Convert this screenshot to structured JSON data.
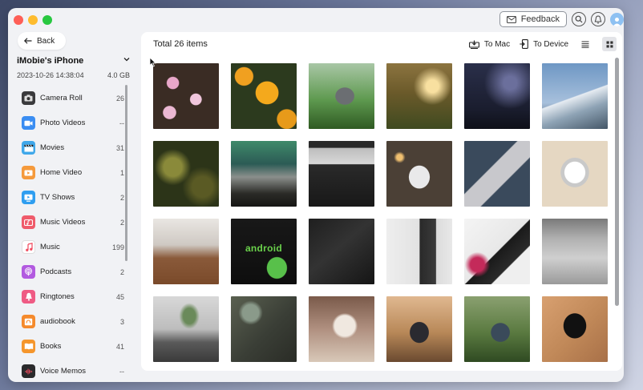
{
  "window": {
    "feedback_label": "Feedback"
  },
  "sidebar": {
    "back_label": "Back",
    "device_name": "iMobie's iPhone",
    "device_date": "2023-10-26 14:38:04",
    "device_size": "4.0 GB",
    "items": [
      {
        "label": "Camera Roll",
        "count": "26",
        "icon": "camera-icon",
        "color": "#3a3a3c"
      },
      {
        "label": "Photo Videos",
        "count": "--",
        "icon": "photo-video-icon",
        "color": "#3a8df2"
      },
      {
        "label": "Movies",
        "count": "31",
        "icon": "clapperboard-icon",
        "color": "#40a8ea"
      },
      {
        "label": "Home Video",
        "count": "1",
        "icon": "home-video-icon",
        "color": "#f59a3c"
      },
      {
        "label": "TV Shows",
        "count": "2",
        "icon": "tv-icon",
        "color": "#2f9ef0"
      },
      {
        "label": "Music Videos",
        "count": "2",
        "icon": "music-video-icon",
        "color": "#ef5b6b"
      },
      {
        "label": "Music",
        "count": "199",
        "icon": "music-note-icon",
        "color": "#ffffff"
      },
      {
        "label": "Podcasts",
        "count": "2",
        "icon": "podcast-icon",
        "color": "#b25ae0"
      },
      {
        "label": "Ringtones",
        "count": "45",
        "icon": "bell-icon",
        "color": "#ef5b84"
      },
      {
        "label": "audiobook",
        "count": "3",
        "icon": "audiobook-icon",
        "color": "#f58a2c"
      },
      {
        "label": "Books",
        "count": "41",
        "icon": "book-icon",
        "color": "#f5962c"
      },
      {
        "label": "Voice Memos",
        "count": "--",
        "icon": "voice-memo-icon",
        "color": "#2a2a2c"
      }
    ]
  },
  "main": {
    "title": "Total 26 items",
    "to_mac_label": "To Mac",
    "to_device_label": "To Device",
    "photos": [
      {
        "name": "photo-pink-daisies",
        "bg": "radial-gradient(circle at 30% 30%,#e8a7c9 0 9%,transparent 10%),radial-gradient(circle at 65% 55%,#f0c6dc 0 10%,transparent 11%),radial-gradient(circle at 25% 75%,#ebb8d3 0 9%,transparent 10%),#3a2c24"
      },
      {
        "name": "photo-orange-flowers",
        "bg": "radial-gradient(circle at 55% 45%,#f4a91c 0 22%,transparent 23%),radial-gradient(circle at 20% 20%,#f0a020 0 12%,transparent 13%),radial-gradient(circle at 85% 85%,#e79a1a 0 12%,transparent 13%),#2c3a1e"
      },
      {
        "name": "photo-cat-grass",
        "bg": "radial-gradient(ellipse at 55% 50%,#6b6e72 0 18%,transparent 19%),linear-gradient(180deg,#a9c7a6 0%,#5f9a50 55%,#2f5a22 100%)"
      },
      {
        "name": "photo-sunset-field",
        "bg": "radial-gradient(circle at 70% 35%,#f8e0a0 0 10%,transparent 30%),linear-gradient(180deg,#8c7440 0%,#6b5a2a 45%,#3f4a20 100%)"
      },
      {
        "name": "photo-night-sky",
        "bg": "radial-gradient(ellipse at 70% 30%,#6b6f9c 0 10%,transparent 40%),linear-gradient(180deg,#2a2f4a 0%,#1a1d2e 70%,#0e1018 100%)"
      },
      {
        "name": "photo-snowy-mountain",
        "bg": "linear-gradient(160deg,transparent 50%,#e6ecf2 51%,#8ea3b5 70%,#445667 100%),linear-gradient(180deg,#6e97c4 0%,#a7c0dc 60%,#3a4c5c 100%)"
      },
      {
        "name": "photo-tree-canopy",
        "bg": "radial-gradient(circle at 30% 40%,#8a8a3a 0 15%,transparent 30%),radial-gradient(circle at 75% 70%,#5a5a24 0 15%,transparent 30%),#2c3418"
      },
      {
        "name": "photo-aurora-mountains",
        "bg": "linear-gradient(180deg,#3f8a6a 0%,#2c5b55 35%,#8b8f8c 55%,#2b2b27 80%,#161614 100%)"
      },
      {
        "name": "photo-laptop-top",
        "bg": "linear-gradient(180deg,#2a2a2a 0%,#2a2a2a 10%,#bdbdbd 11%,#d8d8d8 35%,#2a2a2a 36%,#181818 100%)"
      },
      {
        "name": "photo-iphone-lights",
        "bg": "radial-gradient(ellipse at 50% 55%,#e9e9ea 0 22%,transparent 23%),radial-gradient(circle at 20% 25%,#f0c070 0 4%,transparent 8%),#4b4036"
      },
      {
        "name": "photo-iphone-pencil",
        "bg": "linear-gradient(135deg,transparent 40%,#c8c8cc 41%,#c8c8cc 62%,transparent 63%),#3a4a5c"
      },
      {
        "name": "photo-ipad-desk",
        "bg": "radial-gradient(ellipse at 50% 48%,#ffffff 0 22%,#c9c9c9 23%,#c9c9c9 30%,transparent 31%),#e5d7c2"
      },
      {
        "name": "photo-laptop-wood-desk",
        "bg": "linear-gradient(180deg,#e9e6e2 0%,#cfc9c3 40%,#8a5a3a 60%,#7a4a2a 100%)"
      },
      {
        "name": "photo-android-robot",
        "bg": "radial-gradient(ellipse at 70% 75%,#58c04a 0 15%,transparent 16%),linear-gradient(180deg,#181818 0%,#0e0e0e 100%)",
        "label": "android"
      },
      {
        "name": "photo-dark-phones",
        "bg": "linear-gradient(140deg,#1f1f1f 0%,#333 45%,#151515 100%)"
      },
      {
        "name": "photo-phone-notebook",
        "bg": "linear-gradient(90deg,#eeeeee 0%,#e2e2e2 50%,#2a2a2a 51%,#3a3a3a 75%,#dcdcdc 76%,#e8e8e8 100%)"
      },
      {
        "name": "photo-earbuds-phone",
        "bg": "radial-gradient(circle at 20% 70%,#c42a5a 0 10%,transparent 18%),linear-gradient(135deg,#f4f4f4 0%,#e8e8e8 50%,#1a1a1a 51%,#2a2a2a 70%,#efefef 71%,#efefef 100%)"
      },
      {
        "name": "photo-desk-setup",
        "bg": "linear-gradient(180deg,#7a7a7a 0%,#b0b0b0 30%,#cfcfcf 60%,#9a9a9a 100%)"
      },
      {
        "name": "photo-laptop-plant",
        "bg": "radial-gradient(ellipse at 55% 30%,#6a8a5a 0 12%,transparent 20%),linear-gradient(180deg,#d8d8d8 0%,#bdbdbd 50%,#5a5a5a 70%,#3a3a3a 100%)"
      },
      {
        "name": "photo-phone-table-top",
        "bg": "radial-gradient(circle at 30% 25%,#8a9a8a 0 12%,transparent 18%),linear-gradient(135deg,#5a6050 0%,#3a3e36 55%,#2a2c26 100%)"
      },
      {
        "name": "photo-hand-phone-coffee",
        "bg": "radial-gradient(ellipse at 55% 45%,#f0e8e0 0 20%,transparent 25%),linear-gradient(180deg,#7a5a4a 0%,#b09080 50%,#d8c8b8 100%)"
      },
      {
        "name": "photo-phone-photo-food",
        "bg": "radial-gradient(ellipse at 50% 55%,#2a2a30 0 20%,transparent 21%),linear-gradient(180deg,#e0b890 0%,#b88858 55%,#6a4a30 100%)"
      },
      {
        "name": "photo-phone-greenery",
        "bg": "radial-gradient(ellipse at 55% 55%,#3a4a5a 0 18%,transparent 19%),linear-gradient(180deg,#8aa070 0%,#5a7a40 55%,#2f4a22 100%)"
      },
      {
        "name": "photo-iphone-cable",
        "bg": "radial-gradient(ellipse at 50% 45%,#111 0 24%,transparent 25%),linear-gradient(135deg,#d8a070 0%,#c08858 55%,#a87048 100%)"
      }
    ]
  }
}
